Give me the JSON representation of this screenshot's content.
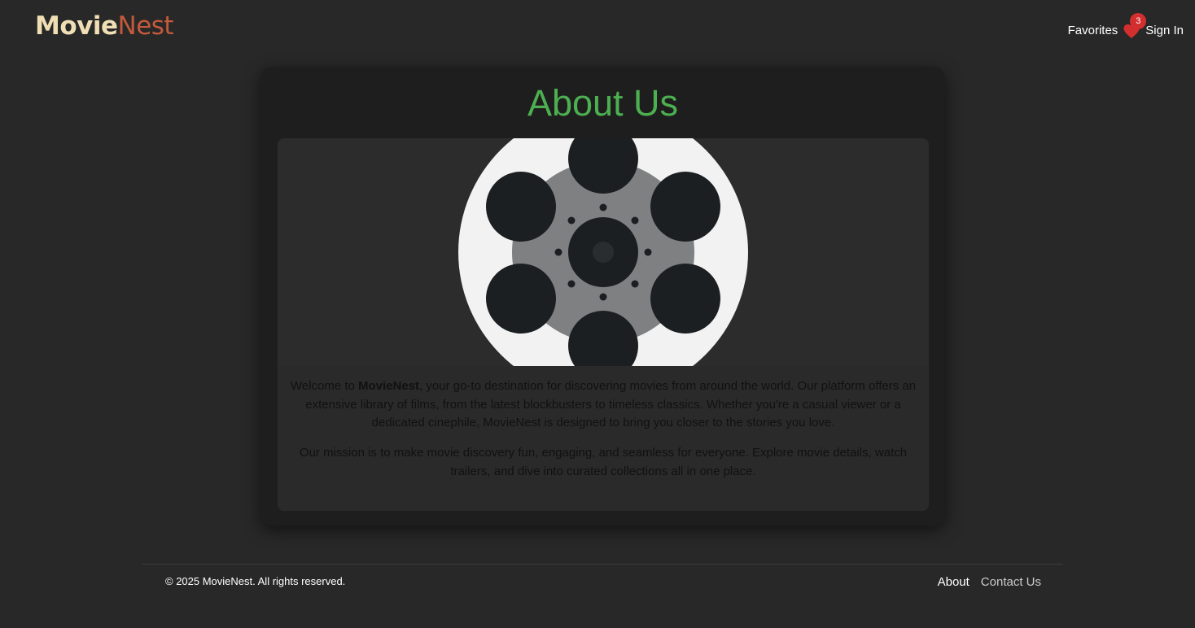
{
  "brand": {
    "part1": "Movie",
    "part2": "Nest",
    "color1": "#f0dfb4",
    "color2": "#c35a3b"
  },
  "nav": {
    "favorites_label": "Favorites",
    "favorites_count": "3",
    "signin_label": "Sign In",
    "heart_icon": "heart-icon"
  },
  "about": {
    "title": "About Us",
    "image": "film-reel",
    "p1_before": "Welcome to ",
    "p1_bold": "MovieNest",
    "p1_after": ", your go-to destination for discovering movies from around the world. Our platform offers an extensive library of films, from the latest blockbusters to timeless classics. Whether you're a casual viewer or a dedicated cinephile, MovieNest is designed to bring you closer to the stories you love.",
    "p2": "Our mission is to make movie discovery fun, engaging, and seamless for everyone. Explore movie details, watch trailers, and dive into curated collections all in one place."
  },
  "footer": {
    "copyright": "© 2025 MovieNest. All rights reserved.",
    "links": [
      "About",
      "Contact Us"
    ]
  },
  "colors": {
    "accent": "#4caf50",
    "badge": "#d32f2f",
    "background": "#282828"
  }
}
